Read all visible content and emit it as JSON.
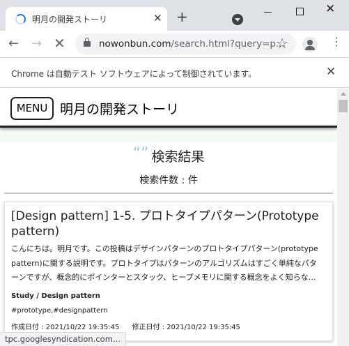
{
  "browser": {
    "tab_title": "明月の開発ストーリ",
    "tab_close": "✕",
    "new_tab": "+",
    "url_host": "nowonbun.com",
    "url_rest": "/search.html?query=p...",
    "star": "☆",
    "menu": "⋮",
    "back": "←",
    "forward": "→",
    "stop": "✕",
    "win_close": "✕"
  },
  "infobar": {
    "text": "Chrome は自動テスト ソフトウェアによって制御されています。",
    "close": "✕"
  },
  "site": {
    "menu_label": "MENU",
    "title": "明月の開発ストーリ"
  },
  "search": {
    "quote": "“”",
    "heading": "検索結果",
    "count_label": "検索件数 : ",
    "count_value": "",
    "count_unit": "件"
  },
  "results": [
    {
      "title": "[Design pattern] 1-5. プロトタイプパターン(Prototype pattern)",
      "excerpt": "こんにちは。明月です。この投稿はデザインパターンのプロトタイプパターン(prototype pattern)に関する説明です。プロトタイプはパターンのアルゴリズムはすごく単純なパターンですが、概念的にポインターとスタック、ヒープメモリに関する概念をよく知らな…",
      "category": "Study / Design pattern",
      "tags": "#prototype,#designpattern",
      "created": "作成日付 : 2021/10/22 19:35:45",
      "modified": "修正日付 : 2021/10/22 19:35:45"
    }
  ],
  "status_bar": "tpc.googlesyndication.com..."
}
